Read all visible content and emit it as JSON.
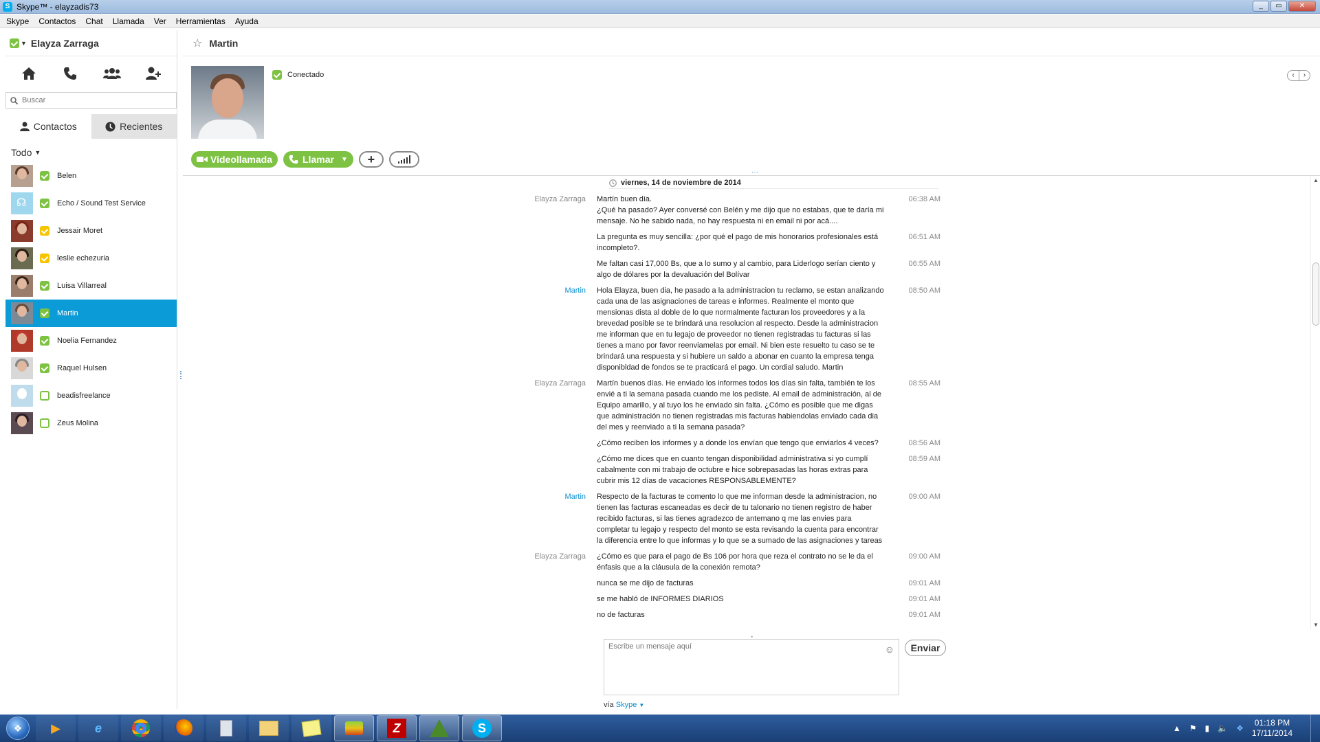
{
  "window": {
    "title": "Skype™ - elayzadis73",
    "controls": [
      "_",
      "▭",
      "✕"
    ]
  },
  "menu": [
    "Skype",
    "Contactos",
    "Chat",
    "Llamada",
    "Ver",
    "Herramientas",
    "Ayuda"
  ],
  "sidebar": {
    "profile_name": "Elayza Zarraga",
    "search_placeholder": "Buscar",
    "tabs": [
      "Contactos",
      "Recientes"
    ],
    "filter": "Todo",
    "contacts": [
      {
        "name": "Belen",
        "status": "online"
      },
      {
        "name": "Echo / Sound Test Service",
        "status": "online"
      },
      {
        "name": "Jessair Moret",
        "status": "away"
      },
      {
        "name": "leslie echezuria",
        "status": "away"
      },
      {
        "name": "Luisa Villarreal",
        "status": "online"
      },
      {
        "name": "Martin",
        "status": "online",
        "selected": true
      },
      {
        "name": "Noelia Fernandez",
        "status": "online"
      },
      {
        "name": "Raquel Hulsen",
        "status": "online"
      },
      {
        "name": "beadisfreelance",
        "status": "offline"
      },
      {
        "name": "Zeus Molina",
        "status": "offline"
      }
    ]
  },
  "main": {
    "contact_name": "Martin",
    "presence": "Conectado",
    "actions": {
      "video": "Videollamada",
      "call": "Llamar",
      "add": "+"
    },
    "date_header": "viernes, 14 de noviembre de 2014",
    "messages": [
      {
        "sender": "Elayza Zarraga",
        "text": "Martín buen día.\n¿Qué ha pasado? Ayer conversé con Belén y me dijo que no estabas, que te daría mi mensaje. No he sabido nada, no hay respuesta ni en email ni por acá....",
        "time": "06:38 AM"
      },
      {
        "sender": "",
        "text": "La pregunta es muy sencilla: ¿por qué el pago de mis honorarios profesionales está incompleto?.",
        "time": "06:51 AM"
      },
      {
        "sender": "",
        "text": "Me faltan casi 17,000 Bs, que a lo sumo y al cambio, para Liderlogo serían ciento y algo de dólares por la devaluación del Bolívar",
        "time": "06:55 AM"
      },
      {
        "sender": "Martin",
        "text": "Hola Elayza, buen dia, he pasado a la administracion tu reclamo, se estan analizando cada una de las asignaciones de tareas e informes. Realmente el monto que mensionas dista al doble de lo que normalmente facturan los proveedores y a la brevedad posible se te brindará una resolucion al respecto. Desde la administracion me informan que en tu legajo de proveedor no tienen registradas tu facturas si las tienes a mano por favor reenviamelas por email. Ni bien este resuelto tu caso se te brindará una respuesta y si hubiere un saldo a abonar en cuanto la empresa tenga disponibldad de fondos se te practicará el pago. Un cordial saludo. Martin",
        "time": "08:50 AM"
      },
      {
        "sender": "Elayza Zarraga",
        "text": "Martín buenos días. He enviado los informes todos los días sin falta, también te los envié a ti la semana pasada cuando me los pediste. Al email de administración, al de Equipo amarillo, y al tuyo los he enviado sin falta. ¿Cómo es posible que me digas que administración no tienen registradas mis facturas habiendolas enviado cada dia del mes y reenviado a ti la semana pasada?",
        "time": "08:55 AM"
      },
      {
        "sender": "",
        "text": "¿Cómo reciben los informes y a donde los envían que tengo que enviarlos 4 veces?",
        "time": "08:56 AM"
      },
      {
        "sender": "",
        "text": "¿Cómo me dices que en cuanto tengan disponibilidad administrativa si yo cumplí cabalmente con mi trabajo de octubre e hice sobrepasadas las horas extras para cubrir mis 12 días de vacaciones RESPONSABLEMENTE?",
        "time": "08:59 AM"
      },
      {
        "sender": "Martin",
        "text": "Respecto de la facturas te comento lo que me informan desde la administracion, no tienen las facturas escaneadas es decir de tu talonario no tienen registro de haber recibido facturas, si las tienes agradezco de antemano q me las envies para completar tu legajo y respecto del monto se esta revisando la cuenta para encontrar la diferencia entre lo que informas y lo que se a sumado de las asignaciones y tareas",
        "time": "09:00 AM"
      },
      {
        "sender": "Elayza Zarraga",
        "text": "¿Cómo es que para el pago de Bs 106 por hora que reza el contrato no se le da el énfasis que a la cláusula de la conexión remota?",
        "time": "09:00 AM"
      },
      {
        "sender": "",
        "text": "nunca se me dijo de facturas",
        "time": "09:01 AM"
      },
      {
        "sender": "",
        "text": "se me habló de INFORMES DIARIOS",
        "time": "09:01 AM"
      },
      {
        "sender": "",
        "text": "no de facturas",
        "time": "09:01 AM"
      }
    ],
    "compose_placeholder": "Escribe un mensaje aquí",
    "send_label": "Enviar",
    "via_prefix": "vía",
    "via_link": "Skype"
  },
  "taskbar": {
    "apps": [
      "media-player",
      "internet-explorer",
      "chrome",
      "firefox",
      "calculator",
      "file-explorer",
      "sticky-notes",
      "bluestacks",
      "filezilla",
      "tree-app",
      "skype"
    ],
    "clock_time": "01:18 PM",
    "clock_date": "17/11/2014"
  },
  "colors": {
    "accent_green": "#7dc242",
    "selection_blue": "#0b9bd7",
    "link_blue": "#0b8fd0"
  }
}
